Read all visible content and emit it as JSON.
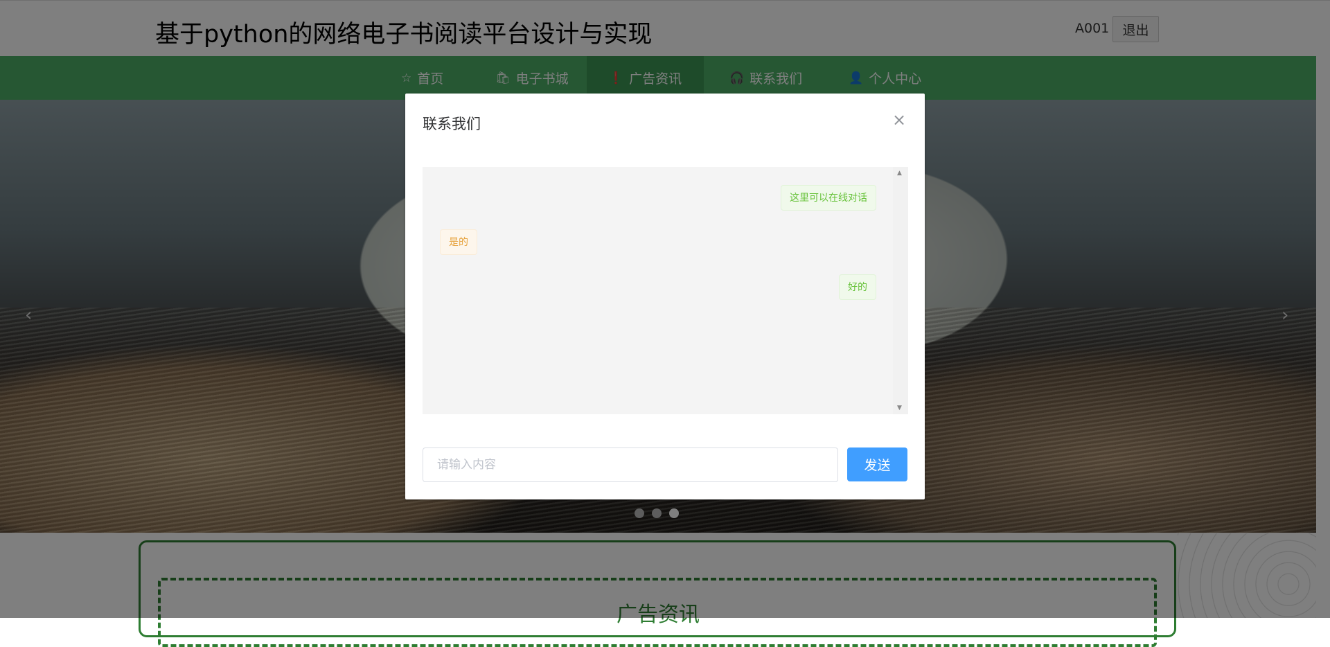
{
  "header": {
    "site_title": "基于python的网络电子书阅读平台设计与实现",
    "user_name": "A001",
    "logout_label": "退出"
  },
  "nav": {
    "items": [
      {
        "label": "首页",
        "icon": "star-icon"
      },
      {
        "label": "电子书城",
        "icon": "shopping-bag-icon"
      },
      {
        "label": "广告资讯",
        "icon": "info-circle-icon",
        "active": true
      },
      {
        "label": "联系我们",
        "icon": "headset-icon"
      },
      {
        "label": "个人中心",
        "icon": "user-icon"
      }
    ]
  },
  "carousel": {
    "arrows": [
      "‹",
      "›"
    ],
    "active_slide": 3,
    "slide_count": 3
  },
  "section": {
    "title": "广告资讯"
  },
  "dialog": {
    "title": "联系我们",
    "close_symbol": "×",
    "messages": [
      {
        "text": "这里可以在线对话",
        "side": "right"
      },
      {
        "text": "是的",
        "side": "left"
      },
      {
        "text": "好的",
        "side": "right"
      }
    ],
    "input_placeholder": "请输入内容",
    "send_label": "发送"
  },
  "colors": {
    "nav_bg": "#4caf67",
    "nav_active": "#3d9655",
    "primary_button": "#409eff",
    "msg_right_text": "#67c23a",
    "msg_left_text": "#e6a23c",
    "section_green": "#2e7d32"
  }
}
